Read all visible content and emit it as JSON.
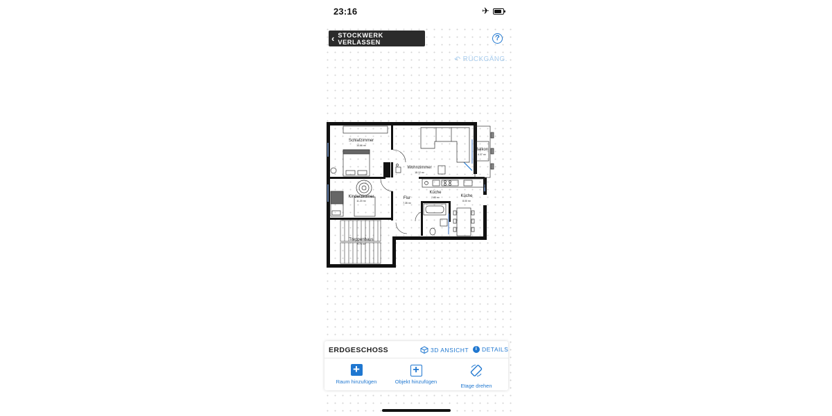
{
  "status_bar": {
    "time": "23:16",
    "airplane_icon": "airplane-icon",
    "battery_icon": "battery-icon"
  },
  "toolbar": {
    "leave_floor_label": "STOCKWERK VERLASSEN",
    "help_label": "?",
    "undo_label": "RÜCKGÄNG."
  },
  "floorplan": {
    "rooms": [
      {
        "name": "Schlafzimmer",
        "area": "14.66 m²"
      },
      {
        "name": "Wohnzimmer",
        "area": "18.12 m²"
      },
      {
        "name": "Balkon",
        "area": "4.37 m²"
      },
      {
        "name": "Kinderzimmer",
        "area": "11.20 m²"
      },
      {
        "name": "Flur",
        "area": "7.35 m²"
      },
      {
        "name": "Küche",
        "area": "2.63 m²"
      },
      {
        "name": "Küche",
        "area": "8.00 m²"
      },
      {
        "name": "Treppenhaus",
        "area": "9.73 m²"
      }
    ]
  },
  "panel": {
    "floor_name": "ERDGESCHOSS",
    "view_3d_label": "3D ANSICHT",
    "details_label": "DETAILS",
    "info_glyph": "i",
    "actions": [
      {
        "label": "Raum hinzufügen",
        "icon": "plus-filled-icon"
      },
      {
        "label": "Objekt hinzufügen",
        "icon": "plus-outline-icon"
      },
      {
        "label": "Etage drehen",
        "icon": "rotate-icon"
      }
    ]
  },
  "colors": {
    "accent": "#1f77d0",
    "wall": "#111111",
    "button_dark": "#2b2b2b",
    "undo_disabled": "#a9cdee"
  }
}
